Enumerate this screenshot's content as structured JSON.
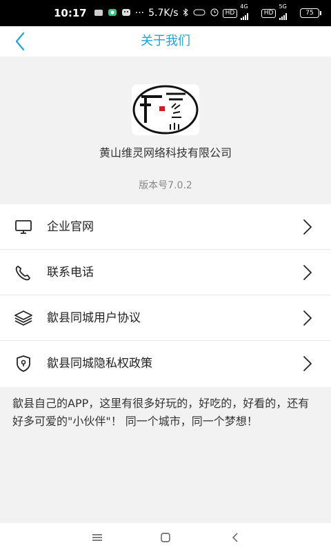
{
  "status_bar": {
    "time": "10:17",
    "more": "···",
    "speed": "5.7K/s",
    "hd1": "HD",
    "net1": "4G",
    "hd2": "HD",
    "net2": "5G",
    "battery": "75"
  },
  "header": {
    "title": "关于我们",
    "back_icon": "chevron-left-icon"
  },
  "about": {
    "company": "黄山维灵网络科技有限公司",
    "version": "版本号7.0.2"
  },
  "menu": [
    {
      "label": "企业官网",
      "icon": "monitor-icon"
    },
    {
      "label": "联系电话",
      "icon": "phone-icon"
    },
    {
      "label": "歙县同城用户协议",
      "icon": "layers-icon"
    },
    {
      "label": "歙县同城隐私权政策",
      "icon": "shield-icon"
    }
  ],
  "description": "歙县自己的APP，这里有很多好玩的，好吃的，好看的，还有好多可爱的\"小伙伴\"！ 同一个城市，同一个梦想！",
  "colors": {
    "accent": "#1aa3e0",
    "background": "#f2f2f2"
  }
}
